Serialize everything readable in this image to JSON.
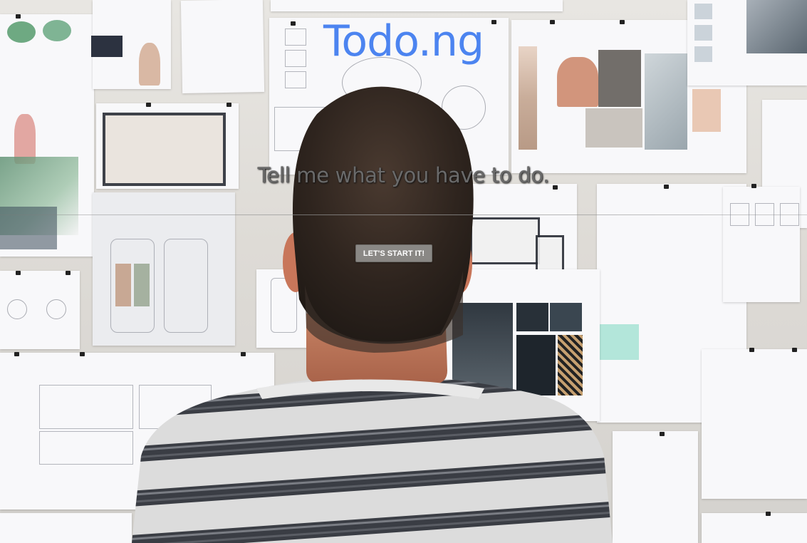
{
  "app": {
    "title": "Todo.ng",
    "tagline": "Tell me what you have to do.",
    "cta_label": "LET'S START IT!"
  },
  "colors": {
    "brand": "#4c84f0",
    "tagline": "#6a6a6a",
    "button_bg": "#8a8885",
    "button_text": "#ffffff"
  },
  "background": {
    "description_icon": "photo-background"
  }
}
